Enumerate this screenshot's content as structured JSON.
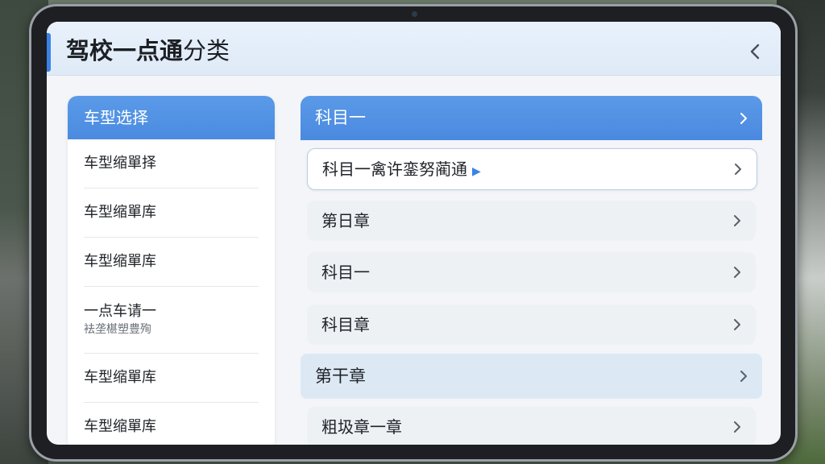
{
  "header": {
    "title_main": "驾校一点通",
    "title_suffix": "分类"
  },
  "left_panel": {
    "header_label": "车型选择",
    "items": [
      {
        "label": "车型缩單择"
      },
      {
        "label": "车型缩單库"
      },
      {
        "label": "车型缩單库"
      },
      {
        "label": "一点车请一",
        "sublabel": "袪垄椹塑豊殉"
      },
      {
        "label": "车型缩單库"
      },
      {
        "label": "车型缩單库"
      }
    ]
  },
  "right_panel": {
    "header_label": "科目一",
    "rows": [
      {
        "label": "科目一禽许銮努蔺通"
      },
      {
        "label": "第日章"
      },
      {
        "label": "科目一"
      },
      {
        "label": "科目章"
      }
    ],
    "section2_label": "第干章",
    "section2_rows": [
      {
        "label": "粗圾章一章"
      }
    ]
  },
  "colors": {
    "accent": "#4b8be0",
    "header_bg": "#e4eefa",
    "row_bg": "#eef1f4"
  },
  "icons": {
    "back": "chevron-left-icon",
    "row": "chevron-right-icon"
  }
}
